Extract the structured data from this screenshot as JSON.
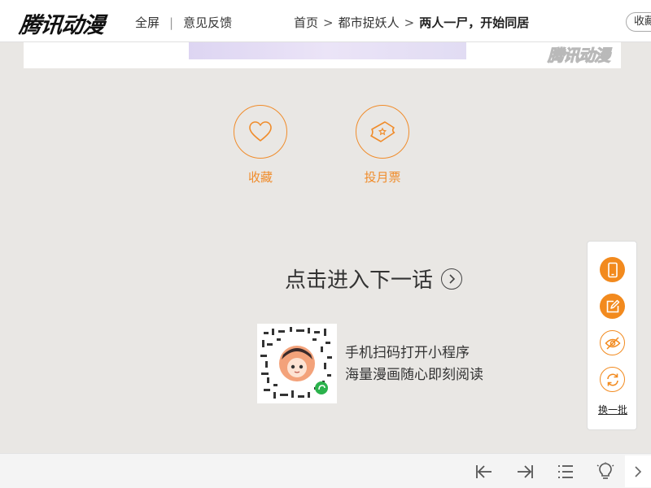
{
  "header": {
    "logo": "腾讯动漫",
    "nav": {
      "fullscreen": "全屏",
      "separator": "|",
      "feedback": "意见反馈"
    },
    "breadcrumb": {
      "home": "首页",
      "series": "都市捉妖人",
      "chapter": "两人一尸，开始同居",
      "arrow": ">"
    },
    "favorite_button": "收藏"
  },
  "page": {
    "watermark": "腾讯动漫"
  },
  "actions": {
    "favorite": {
      "label": "收藏",
      "icon": "heart-icon"
    },
    "monthly_vote": {
      "label": "投月票",
      "icon": "ticket-icon"
    }
  },
  "next_chapter": {
    "label": "点击进入下一话",
    "icon": "chevron-right-circle-icon"
  },
  "mini_program": {
    "line1": "手机扫码打开小程序",
    "line2": "海量漫画随心即刻阅读"
  },
  "sidebar": {
    "items": [
      {
        "name": "phone",
        "icon": "phone-icon"
      },
      {
        "name": "edit",
        "icon": "edit-icon"
      },
      {
        "name": "hide",
        "icon": "eye-off-icon"
      },
      {
        "name": "refresh",
        "icon": "refresh-icon"
      }
    ],
    "change_batch": "换一批"
  },
  "bottombar": {
    "items": [
      "first-page-icon",
      "last-page-icon",
      "list-icon",
      "lightbulb-icon",
      "chevron-right-icon"
    ]
  },
  "colors": {
    "accent": "#f08c2b",
    "background": "#e9e7e4"
  }
}
